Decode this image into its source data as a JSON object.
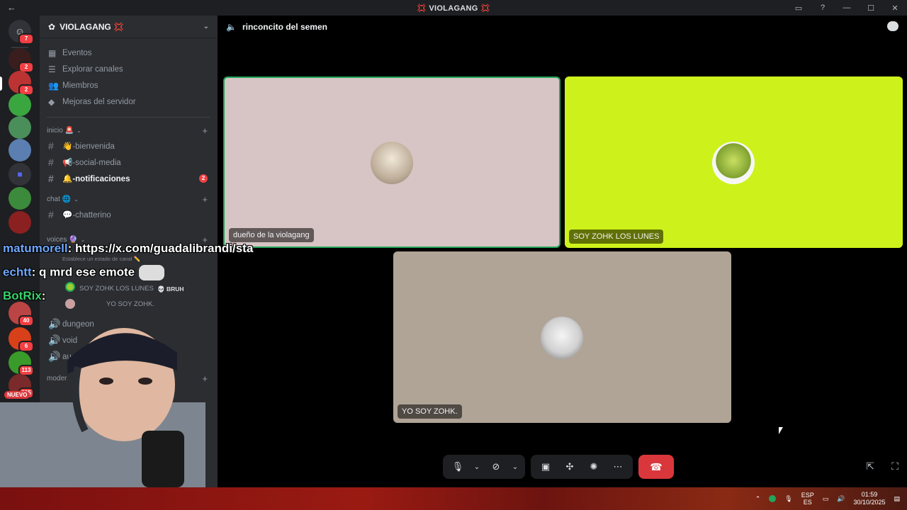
{
  "window": {
    "title": "💢 VIOLAGANG 💢"
  },
  "server": {
    "name": "VIOLAGANG 💢",
    "nav": [
      {
        "label": "Eventos",
        "icon": "calendar-icon"
      },
      {
        "label": "Explorar canales",
        "icon": "list-icon"
      },
      {
        "label": "Miembros",
        "icon": "members-icon"
      },
      {
        "label": "Mejoras del servidor",
        "icon": "boost-icon"
      }
    ],
    "categories": [
      {
        "name": "inicio 🚨",
        "channels": [
          {
            "name": "👋-bienvenida"
          },
          {
            "name": "📢-social-media"
          },
          {
            "name": "🔔-notificaciones",
            "bold": true,
            "mentions": "2"
          }
        ]
      },
      {
        "name": "chat 🌐",
        "channels": [
          {
            "name": "💬-chatterino"
          }
        ]
      },
      {
        "name": "voices 🔮",
        "channels": []
      }
    ],
    "voice_channel": {
      "users": [
        {
          "name": "SOY ZOHK LOS LUNES",
          "tag": "💀 BRUH"
        },
        {
          "name": "YO SOY ZOHK."
        }
      ],
      "status_hint": "Establece un estado de canal ✏️"
    },
    "other_channels": [
      "dungeon",
      "void",
      "au"
    ],
    "moderation_category": "moder"
  },
  "rail": {
    "badges": [
      "7",
      "2",
      "2",
      "40",
      "6",
      "113",
      "395"
    ],
    "new_label": "NUEVO"
  },
  "main": {
    "channel_name": "rinconcito del semen",
    "tiles": [
      {
        "label": "dueño de la violagang",
        "bg": "#d7c4c4"
      },
      {
        "label": "SOY ZOHK LOS LUNES",
        "bg": "#cdf21b"
      },
      {
        "label": "YO SOY ZOHK.",
        "bg": "#b0a497"
      }
    ]
  },
  "overlay_chat": [
    {
      "user": "matumorell",
      "text": ": https://x.com/guadalibrandi/sta"
    },
    {
      "user": "echtt",
      "text": ": q mrd ese emote"
    },
    {
      "user": "BotRix",
      "text": ":"
    }
  ],
  "taskbar": {
    "lang_top": "ESP",
    "lang_bottom": "ES",
    "time": "01:59",
    "date": "30/10/2025"
  },
  "colors": {
    "accent_red": "#da373c",
    "mention_red": "#f23f43",
    "speaking_green": "#23a55a"
  }
}
